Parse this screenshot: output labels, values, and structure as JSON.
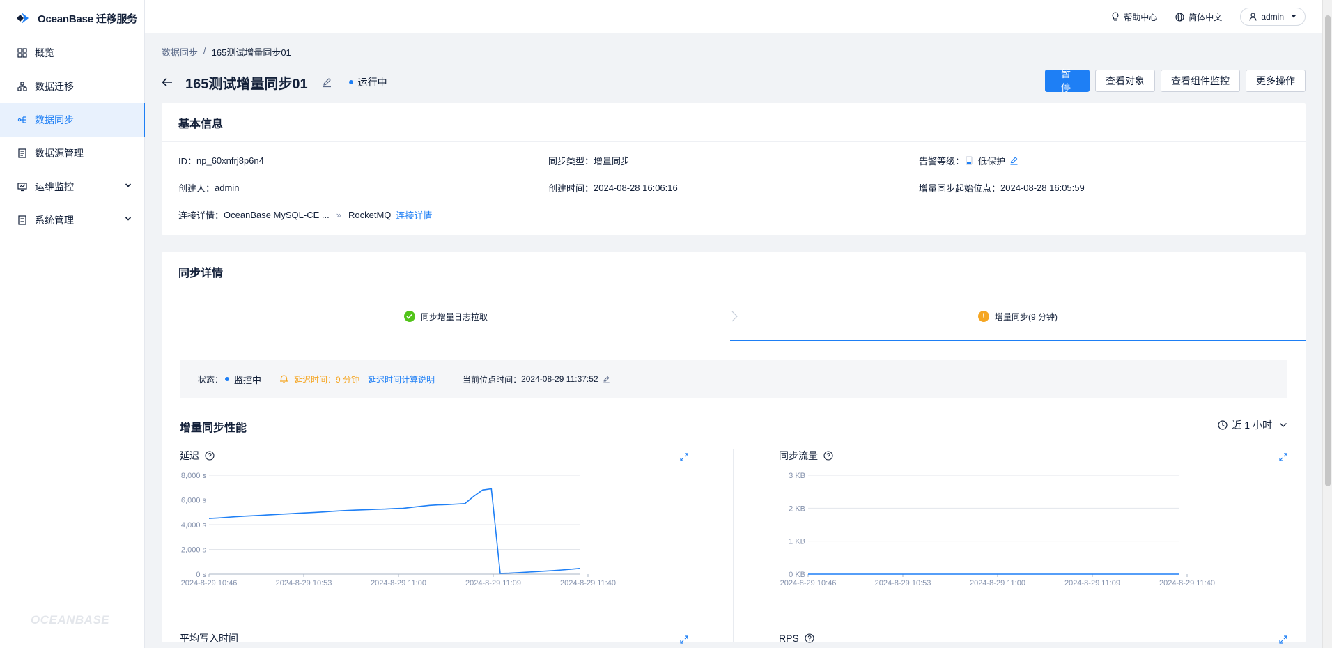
{
  "app": {
    "name": "OceanBase 迁移服务",
    "footer_brand": "OCEANBASE"
  },
  "sidebar": {
    "items": [
      {
        "label": "概览",
        "icon": "dashboard-icon"
      },
      {
        "label": "数据迁移",
        "icon": "migration-icon"
      },
      {
        "label": "数据同步",
        "icon": "sync-icon",
        "active": true
      },
      {
        "label": "数据源管理",
        "icon": "datasource-icon"
      },
      {
        "label": "运维监控",
        "icon": "monitor-icon",
        "expandable": true
      },
      {
        "label": "系统管理",
        "icon": "system-icon",
        "expandable": true
      }
    ]
  },
  "topbar": {
    "help": "帮助中心",
    "language": "简体中文",
    "user": "admin"
  },
  "breadcrumb": {
    "parent": "数据同步",
    "separator": "/",
    "current": "165测试增量同步01"
  },
  "header": {
    "title": "165测试增量同步01",
    "status": "运行中",
    "actions": {
      "pause": "暂停",
      "view_objects": "查看对象",
      "view_component_monitor": "查看组件监控",
      "more": "更多操作"
    }
  },
  "basic_info": {
    "title": "基本信息",
    "id_label": "ID：",
    "id_value": "np_60xnfrj8p6n4",
    "sync_type_label": "同步类型：",
    "sync_type_value": "增量同步",
    "alert_level_label": "告警等级：",
    "alert_level_value": "低保护",
    "creator_label": "创建人：",
    "creator_value": "admin",
    "created_time_label": "创建时间：",
    "created_time_value": "2024-08-28 16:06:16",
    "start_point_label": "增量同步起始位点：",
    "start_point_value": "2024-08-28 16:05:59",
    "connection_label": "连接详情：",
    "connection_source": "OceanBase MySQL-CE ...",
    "connection_arrow": "»",
    "connection_target": "RocketMQ",
    "connection_link": "连接详情"
  },
  "sync_details": {
    "title": "同步详情",
    "steps": [
      {
        "label": "同步增量日志拉取",
        "state": "success"
      },
      {
        "label": "增量同步(9 分钟)",
        "state": "warning",
        "active": true
      }
    ],
    "status_label": "状态：",
    "status_value": "监控中",
    "delay_text": "延迟时间：9 分钟",
    "delay_link": "延迟时间计算说明",
    "position_label": "当前位点时间：",
    "position_value": "2024-08-29 11:37:52",
    "perf_title": "增量同步性能",
    "time_range": "近 1 小时"
  },
  "colors": {
    "accent": "#1e7ff5",
    "warning": "#f5a623",
    "success": "#52c41a"
  },
  "chart_data": [
    {
      "type": "line",
      "title": "延迟",
      "x": [
        "2024-8-29 10:46",
        "2024-8-29 10:53",
        "2024-8-29 11:00",
        "2024-8-29 11:09",
        "2024-8-29 11:40"
      ],
      "x_ticks": [
        "2024-8-29 10:46",
        "2024-8-29 10:53",
        "2024-8-29 11:00",
        "2024-8-29 11:09",
        "2024-8-29 11:40"
      ],
      "y_ticks": [
        "0 s",
        "2,000 s",
        "4,000 s",
        "6,000 s",
        "8,000 s"
      ],
      "ylim": [
        0,
        8000
      ],
      "series": [
        {
          "values": [
            4500,
            4540,
            4590,
            4640,
            4690,
            4720,
            4760,
            4800,
            4840,
            4880,
            4920,
            4950,
            4990,
            5030,
            5080,
            5120,
            5160,
            5190,
            5210,
            5240,
            5260,
            5300,
            5320,
            5400,
            5480,
            5560,
            5600,
            5620,
            5660,
            5700,
            6300,
            6800,
            6900,
            60,
            80,
            120,
            160,
            200,
            240,
            290,
            340,
            400,
            460
          ]
        }
      ]
    },
    {
      "type": "line",
      "title": "同步流量",
      "x_ticks": [
        "2024-8-29 10:46",
        "2024-8-29 10:53",
        "2024-8-29 11:00",
        "2024-8-29 11:09",
        "2024-8-29 11:40"
      ],
      "y_ticks": [
        "0 KB",
        "1 KB",
        "2 KB",
        "3 KB"
      ],
      "ylim": [
        0,
        3
      ],
      "series": [
        {
          "values": [
            0,
            0,
            0,
            0,
            0,
            0,
            0,
            0,
            0,
            0
          ]
        }
      ]
    },
    {
      "type": "line",
      "title": "平均写入时间",
      "series": []
    },
    {
      "type": "line",
      "title": "RPS",
      "series": []
    }
  ]
}
